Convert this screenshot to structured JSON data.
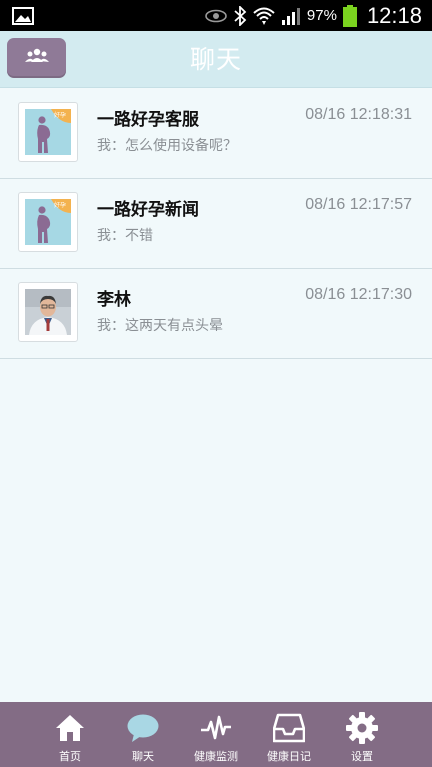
{
  "status_bar": {
    "battery_percent": "97%",
    "time": "12:18",
    "icons": [
      "image-icon",
      "eye-icon",
      "bluetooth-icon",
      "wifi-icon",
      "signal-icon",
      "battery-icon"
    ]
  },
  "header": {
    "title": "聊天",
    "contacts_icon": "contacts-icon"
  },
  "chats": [
    {
      "name": "一路好孕客服",
      "time": "08/16 12:18:31",
      "preview": "我：怎么使用设备呢？",
      "avatar": "pregnancy-logo",
      "badge": "好孕"
    },
    {
      "name": "一路好孕新闻",
      "time": "08/16 12:17:57",
      "preview": "我：不错",
      "avatar": "pregnancy-logo",
      "badge": "好孕"
    },
    {
      "name": "李林",
      "time": "08/16 12:17:30",
      "preview": "我：这两天有点头晕",
      "avatar": "doctor-photo"
    }
  ],
  "bottom_nav": [
    {
      "label": "首页",
      "icon": "home-icon",
      "active": false
    },
    {
      "label": "聊天",
      "icon": "chat-bubble-icon",
      "active": true
    },
    {
      "label": "健康监测",
      "icon": "pulse-icon",
      "active": false
    },
    {
      "label": "健康日记",
      "icon": "inbox-icon",
      "active": false
    },
    {
      "label": "设置",
      "icon": "gear-icon",
      "active": false
    }
  ],
  "colors": {
    "header_bg": "#d3ebf0",
    "accent_purple": "#8f7a97",
    "nav_bg": "#836c85",
    "list_bg": "#f1f9fb",
    "active_icon": "#a9d7e4"
  }
}
